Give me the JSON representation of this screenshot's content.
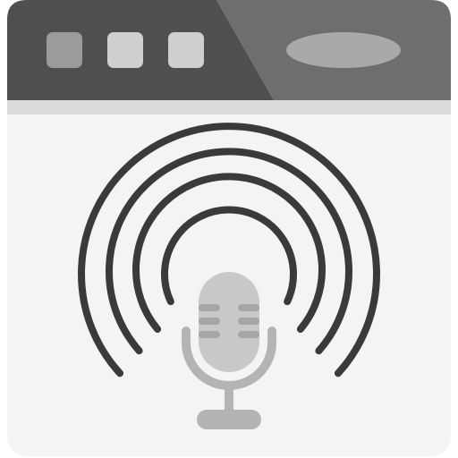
{
  "icon": {
    "name": "podcast-browser-window-icon",
    "window": {
      "titlebar_buttons": [
        "window-button",
        "window-button",
        "window-button"
      ],
      "address_bar": "address-bar-pill"
    },
    "content": {
      "microphone": "microphone-icon",
      "broadcast_waves": 4
    }
  },
  "colors": {
    "titlebar_dark": "#4f4f4f",
    "titlebar_light": "#6e6e6e",
    "divider": "#dcdcdc",
    "content_bg": "#f4f4f4",
    "window_button_dark": "#9b9b9b",
    "window_button_light": "#cfcfcf",
    "address_bar": "#a9a9a9",
    "waves": "#3a3a3a",
    "mic_head": "#c8c8c8",
    "mic_stand": "#b4b4b4",
    "mic_grille": "#a6a6a6"
  }
}
